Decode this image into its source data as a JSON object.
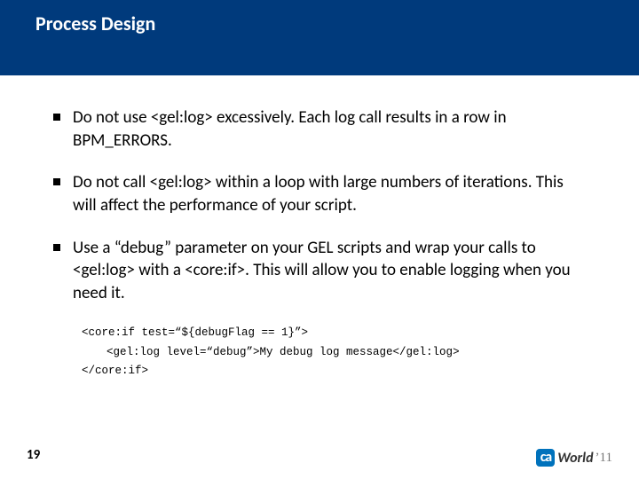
{
  "title": "Process Design",
  "bullets": [
    "Do not use <gel:log> excessively.  Each log call results in a row in BPM_ERRORS.",
    "Do not call <gel:log> within a loop with large numbers of iterations.  This will affect the performance of your script.",
    "Use a “debug” parameter on your GEL scripts and wrap your calls to <gel:log> with a <core:if>.  This will allow you to enable logging when you need it."
  ],
  "code": {
    "l1": "<core:if test=“${debugFlag == 1}”>",
    "l2": "<gel:log level=“debug”>My debug log message</gel:log>",
    "l3": "</core:if>"
  },
  "page": "19",
  "logo": {
    "badge": "ca",
    "text": "World",
    "year": "’11"
  }
}
